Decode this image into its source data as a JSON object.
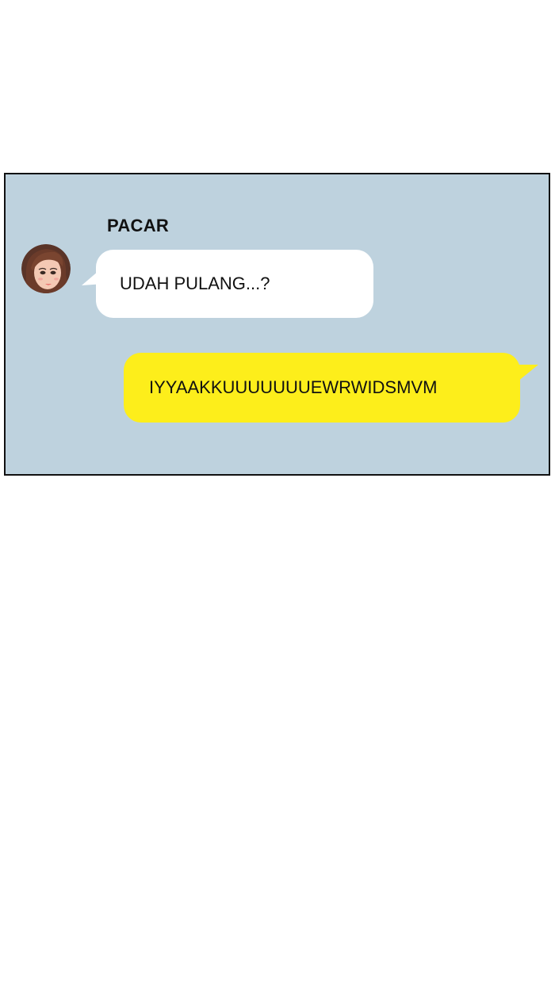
{
  "chat": {
    "sender_name": "PACAR",
    "messages": [
      {
        "direction": "incoming",
        "text": "UDAH PULANG...?"
      },
      {
        "direction": "outgoing",
        "text": "IYYAAKKUUUUUUUEWRWIDSMVM"
      }
    ]
  },
  "colors": {
    "panel_background": "#bed2de",
    "incoming_bubble": "#ffffff",
    "outgoing_bubble": "#fdee1b",
    "border": "#111111"
  },
  "icons": {
    "avatar": "female-contact-avatar"
  }
}
